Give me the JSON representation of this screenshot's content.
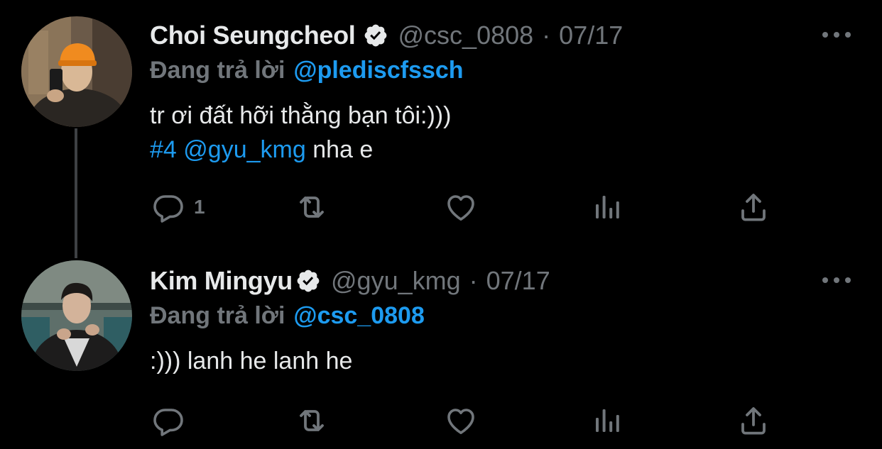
{
  "colors": {
    "background": "#000000",
    "primary_text": "#e7e9ea",
    "secondary_text": "#71767b",
    "accent": "#1d9bf0",
    "thread_line": "#3e4144"
  },
  "tweets": [
    {
      "display_name": "Choi Seungcheol",
      "verified": true,
      "handle": "@csc_0808",
      "separator": "·",
      "date": "07/17",
      "reply_label": "Đang trả lời",
      "reply_handle": "@plediscfssch",
      "text_line1": "tr ơi đất hỡi thằng bạn tôi:)))",
      "hashtag": "#4",
      "mention": "@gyu_kmg",
      "text_line2_rest": " nha e",
      "reply_count": "1",
      "avatar_icon": "avatar-photo-orange-beanie"
    },
    {
      "display_name": "Kim Mingyu",
      "verified": true,
      "handle": "@gyu_kmg",
      "separator": "·",
      "date": "07/17",
      "reply_label": "Đang trả lời",
      "reply_handle": "@csc_0808",
      "text_line1": ":))) lanh he lanh he",
      "reply_count": "",
      "avatar_icon": "avatar-photo-suit"
    }
  ],
  "icons": {
    "reply": "reply-icon",
    "retweet": "retweet-icon",
    "like": "heart-icon",
    "views": "views-icon",
    "share": "share-icon",
    "more": "more-icon",
    "verified": "verified-badge-icon"
  }
}
